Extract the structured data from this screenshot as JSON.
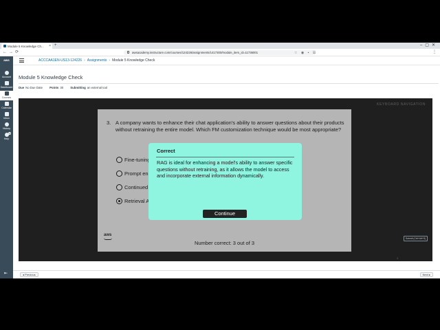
{
  "browser": {
    "tab_title": "Module 5 Knowledge Ch...",
    "new_tab": "+",
    "url": "awsacademy.instructure.com/courses/124226/assignments/1417300/module_item_id=11736001"
  },
  "header": {
    "course": "ACCCAA1EN-US13-124226",
    "section": "Assignments",
    "current": "Module 5 Knowledge Check"
  },
  "global_nav": {
    "logo": "aws",
    "items": [
      {
        "label": "Account"
      },
      {
        "label": "Dashboard"
      },
      {
        "label": "Courses"
      },
      {
        "label": "Calendar"
      },
      {
        "label": "Inbox"
      },
      {
        "label": "History"
      },
      {
        "label": "Help",
        "badge": "10"
      }
    ]
  },
  "assignment": {
    "title": "Module 5 Knowledge Check",
    "due_label": "Due",
    "due_value": "No Due Date",
    "points_label": "Points",
    "points_value": "30",
    "submitting_label": "Submitting",
    "submitting_value": "an external tool"
  },
  "module": {
    "keyboard_nav": "KEYBOARD NAVIGATION",
    "question_number": "3.",
    "question_text": "A company wants to enhance their chat application's ability to answer questions about their products without retraining the entire model. Which FM customization technique would be most appropriate?",
    "options": [
      {
        "label": "Fine-tuning",
        "selected": false
      },
      {
        "label": "Prompt engineering",
        "selected": false
      },
      {
        "label": "Continued pre-training",
        "selected": false
      },
      {
        "label": "Retrieval Augmented Generation (RAG)",
        "selected": true
      }
    ],
    "brand": "aws",
    "number_correct": "Number correct: 3 out of 3",
    "submit_label": "Submit (Ctrl+Alt+S)",
    "pager": "3"
  },
  "modal": {
    "title": "Correct",
    "body": "RAG is ideal for enhancing a model's ability to answer specific questions without retraining, as it allows the model to access and incorporate external information dynamically.",
    "button": "Continue"
  },
  "footer": {
    "previous": "◂ Previous",
    "next": "Next ▸"
  }
}
